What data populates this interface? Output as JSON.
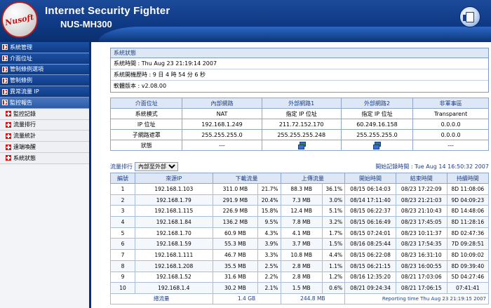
{
  "header": {
    "logo_text": "Nusoft",
    "app_title": "Internet Security Fighter",
    "model": "NUS-MH300"
  },
  "sidebar": {
    "items": [
      {
        "label": "系統管理",
        "active": false
      },
      {
        "label": "介面位址",
        "active": false
      },
      {
        "label": "管制條例選項",
        "active": false
      },
      {
        "label": "管制條例",
        "active": false
      },
      {
        "label": "異常流量 IP",
        "active": false
      },
      {
        "label": "監控報告",
        "active": true
      }
    ],
    "subitems": [
      {
        "label": "監控記錄"
      },
      {
        "label": "流量排行"
      },
      {
        "label": "流量統計"
      },
      {
        "label": "遠端喚醒"
      },
      {
        "label": "系統狀態"
      }
    ]
  },
  "system_status": {
    "caption": "系統狀態",
    "time": "系統時間 : Thu Aug 23 21:19:14 2007",
    "uptime": "系統開機歷時 : 9 日 4 時 54 分 6 秒",
    "firmware": "軟體版本 : v2.08.00"
  },
  "interfaces": {
    "headers": [
      "介面位址",
      "內部網路",
      "外部網路1",
      "外部網路2",
      "非軍事區"
    ],
    "rows": [
      {
        "label": "系統模式",
        "values": [
          "NAT",
          "指定 IP 位址",
          "指定 IP 位址",
          "Transparent"
        ]
      },
      {
        "label": "IP 位址",
        "values": [
          "192.168.1.249",
          "211.72.152.170",
          "60.249.16.158",
          "0.0.0.0"
        ]
      },
      {
        "label": "子網路遮罩",
        "values": [
          "255.255.255.0",
          "255.255.255.248",
          "255.255.255.0",
          "0.0.0.0"
        ]
      },
      {
        "label": "狀態",
        "values": [
          "---",
          "",
          "",
          "---"
        ]
      }
    ]
  },
  "traffic": {
    "label": "流量排行",
    "selected_option": "內部至外部",
    "start_time": "開始記錄時間 : Tue Aug 14 16:50:32 2007",
    "headers": [
      "編號",
      "來源IP",
      "下載流量",
      "上傳流量",
      "開始時間",
      "結束時間",
      "持續時間"
    ],
    "rows": [
      [
        "1",
        "192.168.1.103",
        "311.0 MB",
        "21.7%",
        "88.3 MB",
        "36.1%",
        "08/15 06:14:03",
        "08/23 17:22:09",
        "8D 11:08:06"
      ],
      [
        "2",
        "192.168.1.79",
        "291.9 MB",
        "20.4%",
        "7.3 MB",
        "3.0%",
        "08/14 17:11:40",
        "08/23 21:21:03",
        "9D 04:09:23"
      ],
      [
        "3",
        "192.168.1.115",
        "226.9 MB",
        "15.8%",
        "12.4 MB",
        "5.1%",
        "08/15 06:22:37",
        "08/23 21:10:43",
        "8D 14:48:06"
      ],
      [
        "4",
        "192.168.1.84",
        "136.2 MB",
        "9.5%",
        "7.8 MB",
        "3.2%",
        "08/15 06:16:49",
        "08/23 17:45:05",
        "8D 11:28:16"
      ],
      [
        "5",
        "192.168.1.70",
        "60.9 MB",
        "4.3%",
        "4.1 MB",
        "1.7%",
        "08/15 07:24:01",
        "08/23 10:11:37",
        "8D 02:47:36"
      ],
      [
        "6",
        "192.168.1.59",
        "55.3 MB",
        "3.9%",
        "3.7 MB",
        "1.5%",
        "08/16 08:25:44",
        "08/23 17:54:35",
        "7D 09:28:51"
      ],
      [
        "7",
        "192.168.1.111",
        "46.7 MB",
        "3.3%",
        "10.8 MB",
        "4.4%",
        "08/15 06:22:08",
        "08/23 16:31:10",
        "8D 10:09:02"
      ],
      [
        "8",
        "192.168.1.208",
        "35.5 MB",
        "2.5%",
        "2.8 MB",
        "1.1%",
        "08/15 06:21:15",
        "08/23 16:00:55",
        "8D 09:39:40"
      ],
      [
        "9",
        "192.168.1.52",
        "31.6 MB",
        "2.2%",
        "2.8 MB",
        "1.2%",
        "08/16 12:35:20",
        "08/21 17:03:06",
        "5D 04:27:46"
      ],
      [
        "10",
        "192.168.1.4",
        "30.2 MB",
        "2.1%",
        "1.5 MB",
        "0.6%",
        "08/21 09:24:34",
        "08/21 17:06:15",
        "07:41:41"
      ]
    ],
    "footer": {
      "label": "總流量",
      "download_total": "1.4 GB",
      "upload_total": "244.8 MB",
      "reporting_time": "Reporting time Thu Aug 23 21:19:15 2007"
    }
  },
  "colors": {
    "header_blue": "#0f3a85",
    "caption_bg": "#dde7f5",
    "caption_text": "#1d3f86",
    "logo_red": "#c01010"
  }
}
